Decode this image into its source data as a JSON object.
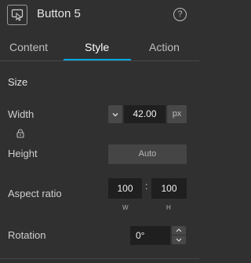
{
  "header": {
    "title": "Button 5",
    "help_glyph": "?"
  },
  "tabs": [
    {
      "label": "Content",
      "active": false
    },
    {
      "label": "Style",
      "active": true
    },
    {
      "label": "Action",
      "active": false
    }
  ],
  "accent_color": "#00a7e1",
  "size": {
    "section_title": "Size",
    "width_label": "Width",
    "width_value": "42.00",
    "width_unit": "px",
    "height_label": "Height",
    "height_value": "Auto",
    "aspect_label": "Aspect ratio",
    "aspect_w": "100",
    "aspect_h": "100",
    "aspect_separator": ":",
    "aspect_w_label": "W",
    "aspect_h_label": "H",
    "rotation_label": "Rotation",
    "rotation_value": "0°"
  },
  "icons": {
    "widget": "button-widget-icon",
    "help": "help-icon",
    "dropdown": "chevron-down-icon",
    "lock": "lock-icon",
    "stepper_up": "chevron-up-icon",
    "stepper_down": "chevron-down-icon"
  }
}
